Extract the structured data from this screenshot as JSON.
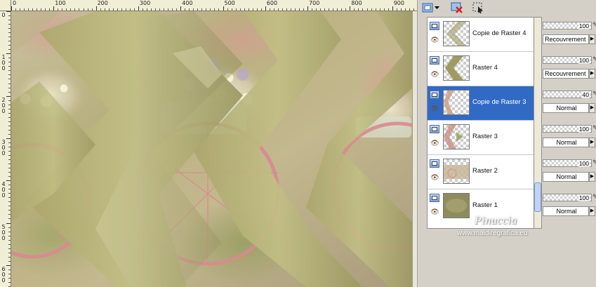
{
  "ruler": {
    "top_labels": [
      "0",
      "100",
      "200",
      "300",
      "400",
      "500",
      "600",
      "700",
      "800",
      "900"
    ],
    "left_labels": [
      "1\n0\n0",
      "2\n0\n0",
      "3\n0\n0",
      "4\n0\n0",
      "5\n0\n0",
      "6\n0\n0"
    ]
  },
  "toolbar": {
    "icons": [
      "new-raster-layer-icon",
      "dropdown-arrow-icon",
      "delete-layer-icon",
      "selection-icon"
    ]
  },
  "layers": [
    {
      "name": "Copie de Raster 4",
      "opacity": "100",
      "blend": "Recouvrement",
      "selected": false
    },
    {
      "name": "Raster 4",
      "opacity": "100",
      "blend": "Recouvrement",
      "selected": false
    },
    {
      "name": "Copie de Raster 3",
      "opacity": "40",
      "blend": "Normal",
      "selected": true
    },
    {
      "name": "Raster 3",
      "opacity": "100",
      "blend": "Normal",
      "selected": false
    },
    {
      "name": "Raster 2",
      "opacity": "100",
      "blend": "Normal",
      "selected": false
    },
    {
      "name": "Raster 1",
      "opacity": "100",
      "blend": "Normal",
      "selected": false
    }
  ],
  "watermark": {
    "name": "Pinuccia",
    "url": "www.maidiregrafica.eu"
  },
  "colors": {
    "selection": "#316ac5",
    "canvas_base": "#b9b38a",
    "chevron": "#b3b073",
    "bike_pink": "#d98a8f"
  }
}
